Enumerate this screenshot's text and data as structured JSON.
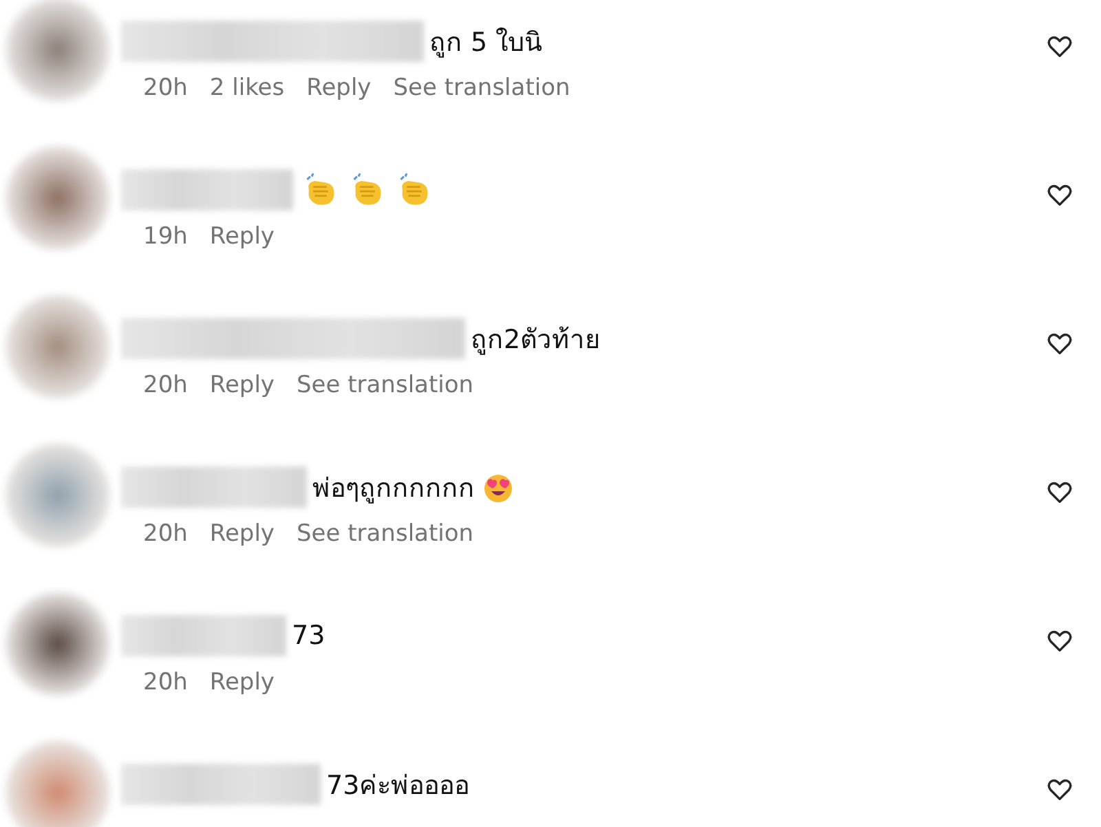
{
  "comments": [
    {
      "text": "ถูก 5 ใบนิ",
      "time": "20h",
      "actions": [
        "2 likes",
        "Reply",
        "See translation"
      ]
    },
    {
      "icons": [
        {
          "kind": "clap"
        },
        {
          "kind": "clap"
        },
        {
          "kind": "clap"
        }
      ],
      "time": "19h",
      "actions": [
        "Reply"
      ]
    },
    {
      "text": "ถูก2ตัวท้าย",
      "time": "20h",
      "actions": [
        "Reply",
        "See translation"
      ]
    },
    {
      "text": "พ่อๆถูกกกกกก",
      "icons": [
        {
          "kind": "heart-eyes"
        }
      ],
      "time": "20h",
      "actions": [
        "Reply",
        "See translation"
      ]
    },
    {
      "text": "73",
      "time": "20h",
      "actions": [
        "Reply"
      ]
    },
    {
      "text": "73ค่ะพ่ออออ"
    }
  ]
}
